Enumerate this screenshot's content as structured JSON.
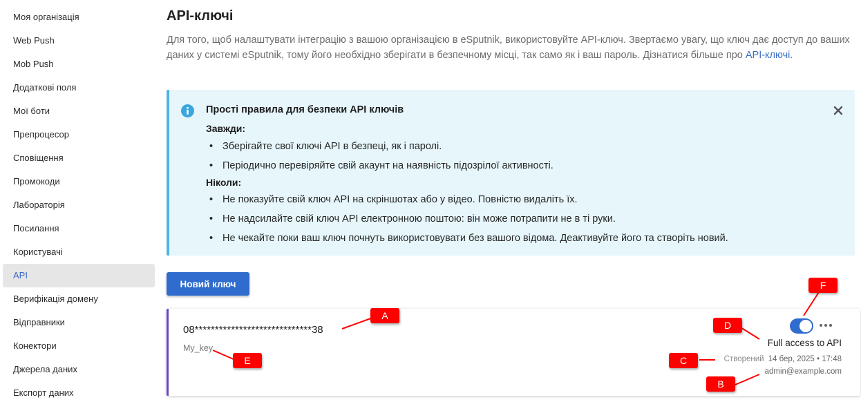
{
  "sidebar": {
    "items": [
      {
        "label": "Моя організація",
        "active": false
      },
      {
        "label": "Web Push",
        "active": false
      },
      {
        "label": "Mob Push",
        "active": false
      },
      {
        "label": "Додаткові поля",
        "active": false
      },
      {
        "label": "Мої боти",
        "active": false
      },
      {
        "label": "Препроцесор",
        "active": false
      },
      {
        "label": "Сповіщення",
        "active": false
      },
      {
        "label": "Промокоди",
        "active": false
      },
      {
        "label": "Лабораторія",
        "active": false
      },
      {
        "label": "Посилання",
        "active": false
      },
      {
        "label": "Користувачі",
        "active": false
      },
      {
        "label": "API",
        "active": true
      },
      {
        "label": "Верифікація домену",
        "active": false
      },
      {
        "label": "Відправники",
        "active": false
      },
      {
        "label": "Конектори",
        "active": false
      },
      {
        "label": "Джерела даних",
        "active": false
      },
      {
        "label": "Експорт даних",
        "active": false
      }
    ]
  },
  "page": {
    "title": "API-ключі",
    "intro_text": "Для того, щоб налаштувати інтеграцію з вашою організацією в eSputnik, використовуйте API-ключ. Звертаємо увагу, що ключ дає доступ до ваших даних у системі eSputnik, тому його необхідно зберігати в безпечному місці, так само як і ваш пароль. Дізнатися більше про ",
    "intro_link": "API-ключі",
    "intro_end": "."
  },
  "notice": {
    "title": "Прості правила для безпеки API ключів",
    "always_label": "Завжди:",
    "always_items": [
      "Зберігайте свої ключі API в безпеці, як і паролі.",
      "Періодично перевіряйте свій акаунт на наявність підозрілої активності."
    ],
    "never_label": "Ніколи:",
    "never_items": [
      "Не показуйте свій ключ API на скріншотах або у відео. Повністю видаліть їх.",
      "Не надсилайте свій ключ API електронною поштою: він може потрапити не в ті руки.",
      "Не чекайте поки ваш ключ почнуть використовувати без вашого відома. Деактивуйте його та створіть новий."
    ]
  },
  "actions": {
    "new_key_label": "Новий ключ"
  },
  "key": {
    "masked_value": "08*****************************38",
    "name": "My_key",
    "enabled": true,
    "access_label": "Full access to API",
    "created_label": "Створений",
    "created_at": "14 бер, 2025 • 17:48",
    "author": "admin@example.com"
  },
  "markers": {
    "a": "A",
    "b": "B",
    "c": "C",
    "d": "D",
    "e": "E",
    "f": "F"
  },
  "colors": {
    "accent": "#2f6ccd",
    "notice_bg": "#e6f6fb",
    "notice_border": "#52b4df",
    "card_border": "#6b46c1",
    "marker": "#ff0000"
  }
}
